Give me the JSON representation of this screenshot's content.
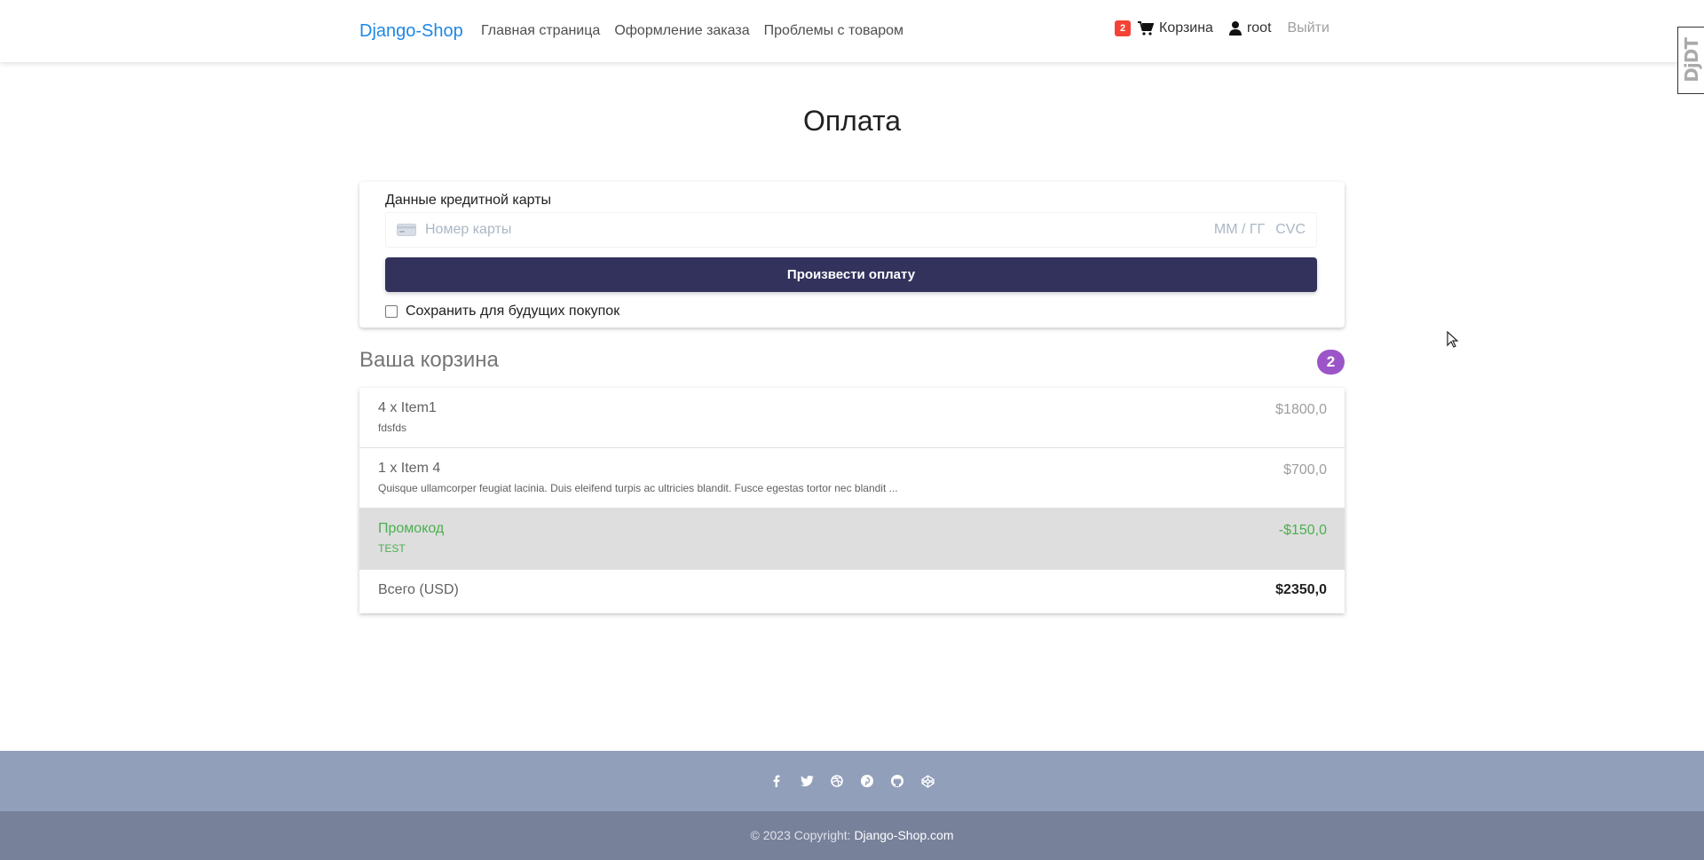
{
  "nav": {
    "brand": "Django-Shop",
    "links": [
      "Главная страница",
      "Оформление заказа",
      "Проблемы с товаром"
    ],
    "cart_count": "2",
    "cart_label": "Корзина",
    "user": "root",
    "logout": "Выйти"
  },
  "toolbar_badge": "DjDT",
  "page": {
    "title": "Оплата"
  },
  "payment": {
    "label": "Данные кредитной карты",
    "card_placeholder": "Номер карты",
    "date_placeholder": "MM / ГГ",
    "cvc_placeholder": "CVC",
    "pay_button": "Произвести оплату",
    "save_label": "Сохранить для будущих покупок",
    "save_checked": false
  },
  "cart": {
    "heading": "Ваша корзина",
    "count": "2",
    "items": [
      {
        "title": "4 x Item1",
        "description": "fdsfds",
        "price": "$1800,0"
      },
      {
        "title": "1 x Item 4",
        "description": "Quisque ullamcorper feugiat lacinia. Duis eleifend turpis ac ultricies blandit. Fusce egestas tortor nec blandit ...",
        "price": "$700,0"
      }
    ],
    "promo": {
      "title": "Промокод",
      "code": "TEST",
      "price": "-$150,0"
    },
    "total": {
      "label": "Всего (USD)",
      "price": "$2350,0"
    }
  },
  "footer": {
    "social_icons": [
      "facebook-icon",
      "twitter-icon",
      "dribbble-icon",
      "pinterest-icon",
      "github-icon",
      "codepen-icon"
    ],
    "copyright": "© 2023 Copyright:",
    "site": "Django-Shop.com"
  },
  "colors": {
    "brand": "#1e88e5",
    "pay_button": "#32325d",
    "badge": "#f44336",
    "count_pill": "#9c55c8",
    "promo": "#4caf50",
    "footer_top": "#929fba",
    "footer_bottom": "#78819a"
  }
}
